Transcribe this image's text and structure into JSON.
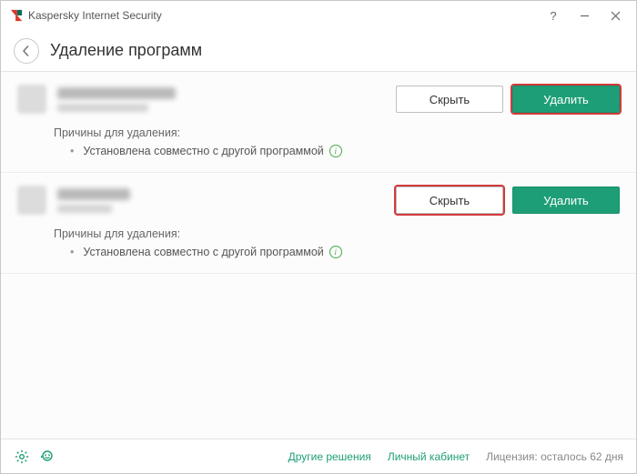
{
  "title": "Kaspersky Internet Security",
  "page_heading": "Удаление программ",
  "buttons": {
    "hide": "Скрыть",
    "delete": "Удалить"
  },
  "reasons_label": "Причины для удаления:",
  "reason_text": "Установлена совместно с другой программой",
  "items": [
    {
      "highlight": "delete"
    },
    {
      "highlight": "hide"
    }
  ],
  "footer": {
    "other": "Другие решения",
    "cabinet": "Личный кабинет",
    "license": "Лицензия: осталось 62 дня"
  }
}
